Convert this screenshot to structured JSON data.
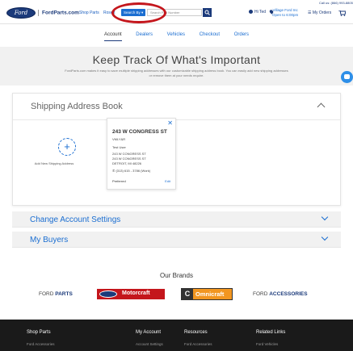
{
  "header": {
    "logo_text": "Ford",
    "site_name": "FordParts.com",
    "nav": [
      "Shop Parts",
      "Rosett"
    ],
    "search_by_label": "Search By",
    "search_placeholder": "Search Part Number",
    "signin_label": "Hi Ted",
    "dealer_name": "Village Ford Inc",
    "dealer_hours": "Open to 6:00pm",
    "my_orders_label": "My Orders",
    "call_us": "Call us: (866) 993-8805"
  },
  "tabs": [
    {
      "label": "Account",
      "active": true
    },
    {
      "label": "Dealers",
      "active": false
    },
    {
      "label": "Vehicles",
      "active": false
    },
    {
      "label": "Checkout",
      "active": false
    },
    {
      "label": "Orders",
      "active": false
    }
  ],
  "banner": {
    "title": "Keep Track Of What's Important",
    "subtitle": "FordParts.com makes it easy to save multiple shipping addresses with our customizable shipping address book. You can easily add new shipping addresses or remove them at your needs require."
  },
  "address_book": {
    "title": "Shipping Address Book",
    "add_label": "Add New Shipping Address",
    "address": {
      "name": "243 W CONGRESS ST",
      "line1": "VMLY&R",
      "contact": "Test User",
      "street1": "243 W CONGRESS ST",
      "street2": "243 W CONGRESS ST",
      "city": "DETROIT, MI 48226",
      "phone": "(313) 615 - 3786 (Work)",
      "preferred": "Preferred",
      "edit": "Edit"
    }
  },
  "sections": [
    "Change Account Settings",
    "My Buyers"
  ],
  "brands": {
    "title": "Our Brands",
    "ford_parts": [
      "FORD ",
      "PARTS"
    ],
    "motorcraft": "Motorcraft",
    "omnicraft_c": "C",
    "omnicraft": "Omnicraft",
    "ford_accessories": [
      "FORD ",
      "ACCESSORIES"
    ]
  },
  "footer": {
    "columns": [
      {
        "heading": "Shop Parts",
        "link": "Ford Accessories"
      },
      {
        "heading": "My Account",
        "link": "Account Settings"
      },
      {
        "heading": "Resources",
        "link": "Ford Accessories"
      },
      {
        "heading": "Related Links",
        "link": "Ford Vehicles"
      }
    ]
  },
  "colors": {
    "ford_blue": "#1b3a7a",
    "link_blue": "#1b6ed1",
    "annotation_red": "#c4161c",
    "footer_bg": "#1a1a1a"
  },
  "icons": [
    "search-icon",
    "user-icon",
    "location-pin-icon",
    "orders-icon",
    "cart-icon",
    "chat-icon",
    "close-icon",
    "phone-icon",
    "chevron-up-icon",
    "chevron-down-icon",
    "plus-icon"
  ]
}
